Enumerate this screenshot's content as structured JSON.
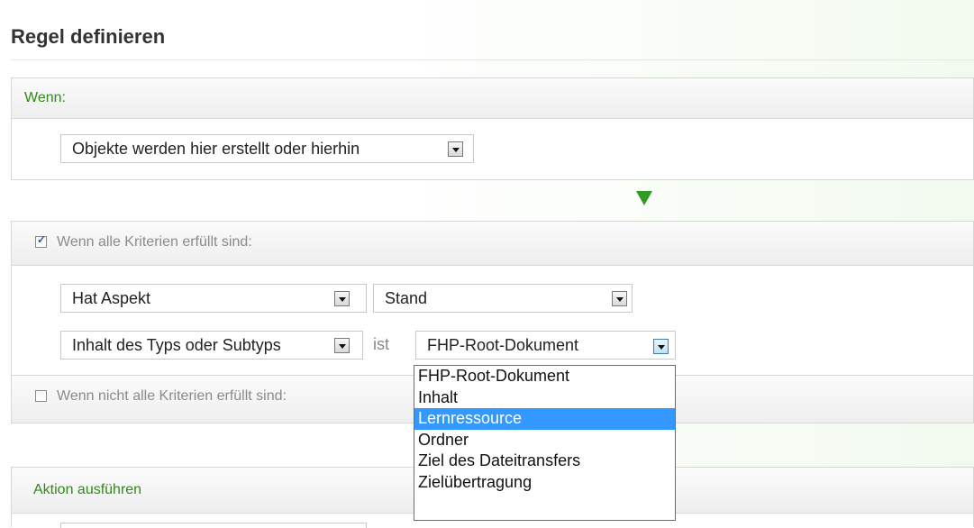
{
  "page": {
    "title": "Regel definieren"
  },
  "when_section": {
    "label": "Wenn:",
    "trigger_select": {
      "value": "Objekte werden hier erstellt oder hierhin"
    }
  },
  "criteria_all": {
    "label": "Wenn alle Kriterien erfüllt sind:",
    "checked": true,
    "row1": {
      "field": "Hat Aspekt",
      "value": "Stand"
    },
    "row2": {
      "field": "Inhalt des Typs oder Subtyps",
      "operator": "ist",
      "value": "FHP-Root-Dokument"
    }
  },
  "criteria_not_all": {
    "label": "Wenn nicht alle Kriterien erfüllt sind:",
    "checked": false
  },
  "type_dropdown": {
    "options": [
      "FHP-Root-Dokument",
      "Inhalt",
      "Lernressource",
      "Ordner",
      "Ziel des Dateitransfers",
      "Zielübertragung"
    ],
    "highlighted": "Lernressource"
  },
  "action_section": {
    "label": "Aktion ausführen"
  },
  "colors": {
    "accent_green": "#2f8a17",
    "selection_blue": "#3399ff",
    "arrow_green": "#2f9a24"
  },
  "icons": {
    "flow_arrow": "arrow-down-icon",
    "dropdown": "chevron-down-icon"
  }
}
